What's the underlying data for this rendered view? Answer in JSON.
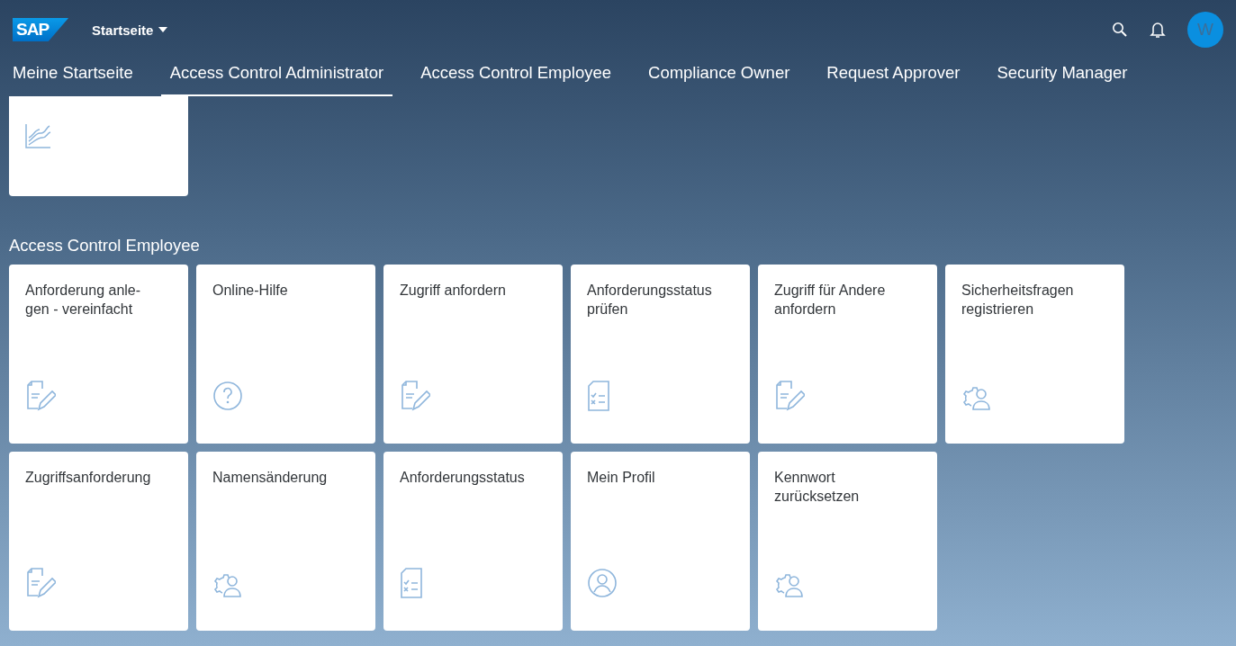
{
  "header": {
    "logo": "SAP",
    "title": "Startseite",
    "avatar": "W"
  },
  "tabs": [
    {
      "label": "Meine Startseite",
      "selected": false
    },
    {
      "label": "Access Control Administrator",
      "selected": true
    },
    {
      "label": "Access Control Employee",
      "selected": false
    },
    {
      "label": "Compliance Owner",
      "selected": false
    },
    {
      "label": "Request Approver",
      "selected": false
    },
    {
      "label": "Security Manager",
      "selected": false
    }
  ],
  "top_tiles": [
    {
      "kind": "chart"
    }
  ],
  "section": {
    "title": "Access Control Employee",
    "tiles": [
      {
        "title": "Anforderung anle-\ngen - vereinfacht",
        "kind": "edit"
      },
      {
        "title": "Online-Hilfe",
        "kind": "help"
      },
      {
        "title": "Zugriff anfordern",
        "kind": "edit"
      },
      {
        "title": "Anforderungsstatus\nprüfen",
        "kind": "status"
      },
      {
        "title": "Zugriff für Andere\nanfordern",
        "kind": "edit"
      },
      {
        "title": "Sicherheitsfragen\nregistrieren",
        "kind": "settings"
      },
      {
        "title": "Zugriffsanforderung",
        "kind": "edit"
      },
      {
        "title": "Namensänderung",
        "kind": "settings"
      },
      {
        "title": "Anforderungsstatus",
        "kind": "status"
      },
      {
        "title": "Mein Profil",
        "kind": "profile"
      },
      {
        "title": "Kennwort\nzurücksetzen",
        "kind": "settings"
      }
    ]
  }
}
